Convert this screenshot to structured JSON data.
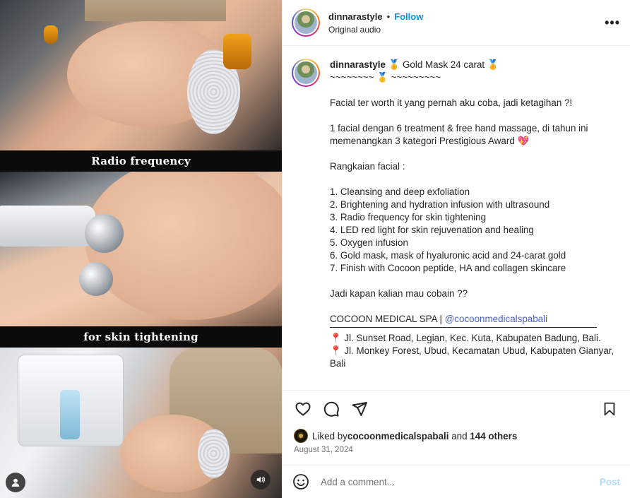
{
  "media": {
    "overlay_top": "Radio frequency",
    "overlay_bottom": "for skin tightening",
    "user_tag_icon": "user-icon",
    "audio_icon": "speaker-icon"
  },
  "header": {
    "username": "dinnarastyle",
    "separator": "•",
    "follow_label": "Follow",
    "audio_label": "Original audio",
    "more_label": "•••"
  },
  "caption": {
    "username": "dinnarastyle",
    "lines": [
      "🏅 Gold Mask 24 carat 🏅",
      "~~~~~~~~ 🥇 ~~~~~~~~~",
      "",
      "Facial ter worth it yang pernah aku coba, jadi ketagihan ?!",
      "",
      "1 facial dengan 6 treatment & free hand massage, di tahun ini memenangkan 3 kategori Prestigious Award 💖",
      "",
      "Rangkaian facial :",
      "",
      "1. Cleansing and deep exfoliation",
      "2. Brightening and hydration infusion with ultrasound",
      "3. Radio frequency for skin tightening",
      "4. LED red light for skin rejuvenation and healing",
      "5. Oxygen infusion",
      "6. Gold mask, mask of hyaluronic acid and 24-carat gold",
      "7. Finish with Cocoon peptide, HA and collagen skincare",
      "",
      "Jadi kapan kalian mau cobain ??",
      ""
    ],
    "spa_name": "COCOON MEDICAL SPA | ",
    "spa_mention": "@cocoonmedicalspabali",
    "locations": [
      "📍 Jl. Sunset Road, Legian, Kec. Kuta, Kabupaten Badung, Bali.",
      "📍 Jl. Monkey Forest, Ubud, Kecamatan Ubud, Kabupaten Gianyar, Bali"
    ]
  },
  "actions": {
    "like_icon": "heart-icon",
    "comment_icon": "comment-icon",
    "share_icon": "send-icon",
    "save_icon": "bookmark-icon"
  },
  "likes": {
    "prefix": "Liked by ",
    "user": "cocoonmedicalspabali",
    "middle": " and ",
    "others": "144 others"
  },
  "date": "August 31, 2024",
  "comment": {
    "placeholder": "Add a comment...",
    "post_label": "Post",
    "emoji_icon": "smiley-icon"
  },
  "colors": {
    "follow": "#0095f6",
    "mention": "#4a5fd0",
    "post_disabled": "#b3dbff",
    "muted": "#737373"
  }
}
